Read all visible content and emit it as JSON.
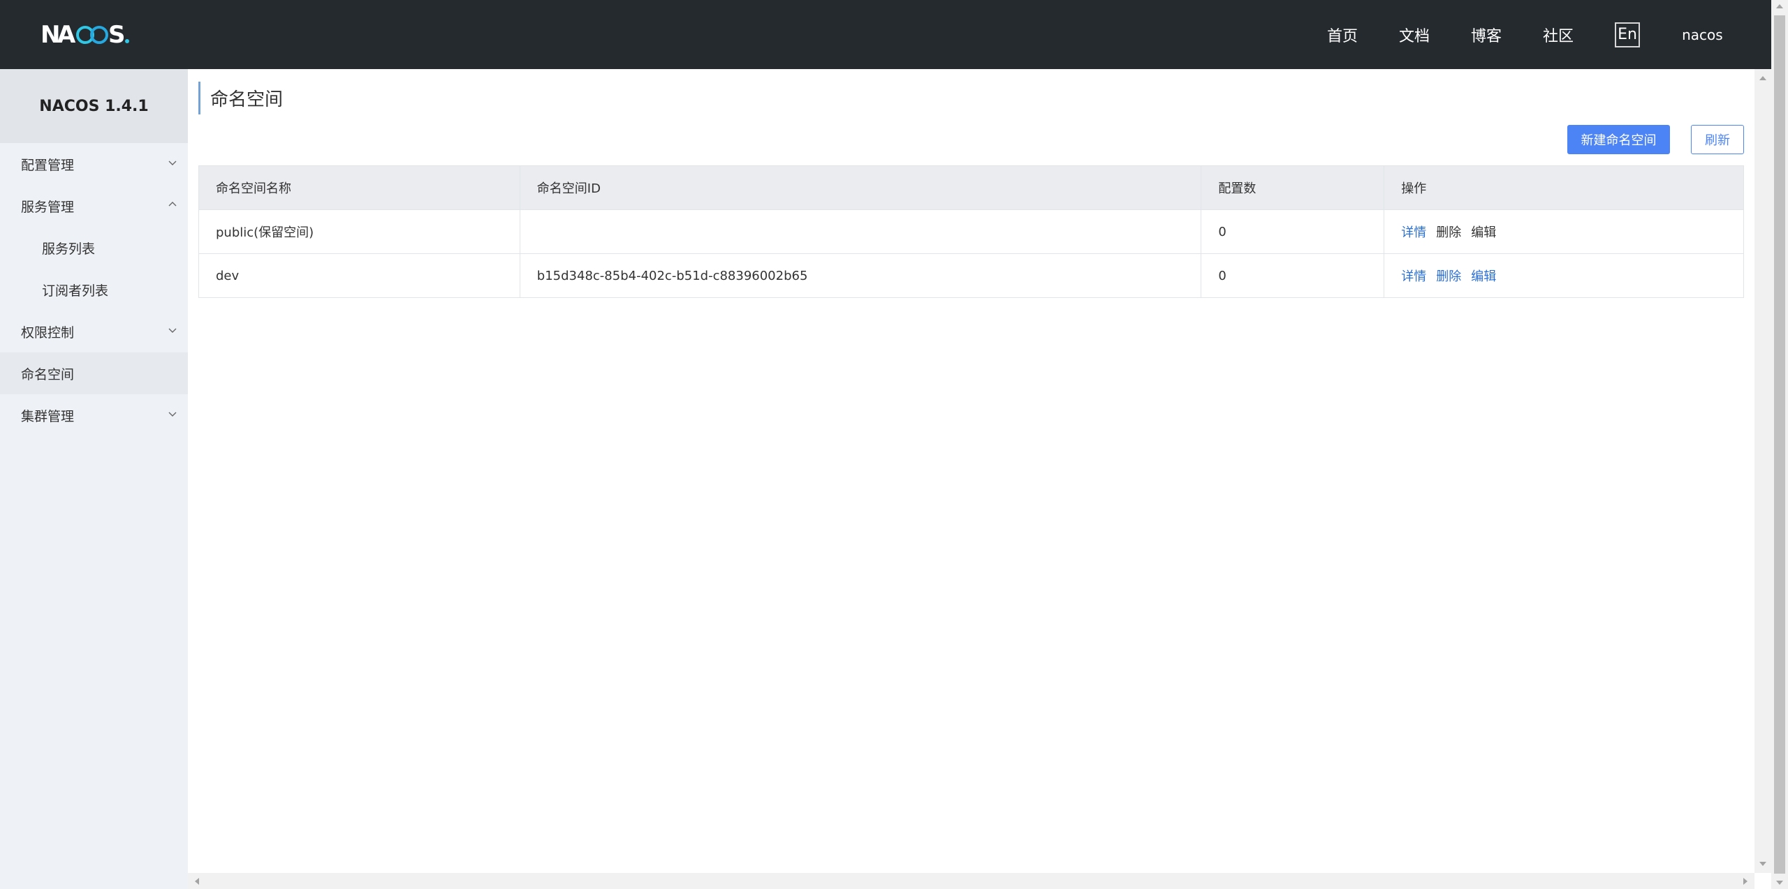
{
  "header": {
    "logo_text": "NACOS.",
    "nav": [
      {
        "label": "首页"
      },
      {
        "label": "文档"
      },
      {
        "label": "博客"
      },
      {
        "label": "社区"
      }
    ],
    "language_label": "En",
    "user": "nacos"
  },
  "sidebar": {
    "title": "NACOS 1.4.1",
    "items": [
      {
        "label": "配置管理",
        "chevron": "down"
      },
      {
        "label": "服务管理",
        "chevron": "up"
      },
      {
        "label": "服务列表"
      },
      {
        "label": "订阅者列表"
      },
      {
        "label": "权限控制",
        "chevron": "down"
      },
      {
        "label": "命名空间",
        "active": true
      },
      {
        "label": "集群管理",
        "chevron": "down"
      }
    ]
  },
  "main": {
    "title": "命名空间",
    "create_button": "新建命名空间",
    "refresh_button": "刷新",
    "table": {
      "headers": [
        "命名空间名称",
        "命名空间ID",
        "配置数",
        "操作"
      ],
      "rows": [
        {
          "name": "public(保留空间)",
          "id": "",
          "count": "0",
          "actions": [
            "详情",
            "删除",
            "编辑"
          ]
        },
        {
          "name": "dev",
          "id": "b15d348c-85b4-402c-b51d-c88396002b65",
          "count": "0",
          "actions": [
            "详情",
            "删除",
            "编辑"
          ]
        }
      ]
    }
  },
  "colors": {
    "header_bg": "#252a2f",
    "sidebar_bg": "#eef1f5",
    "primary": "#4d84f5",
    "link": "#2a6fd6",
    "logo_accent": "#2ec7e6"
  }
}
